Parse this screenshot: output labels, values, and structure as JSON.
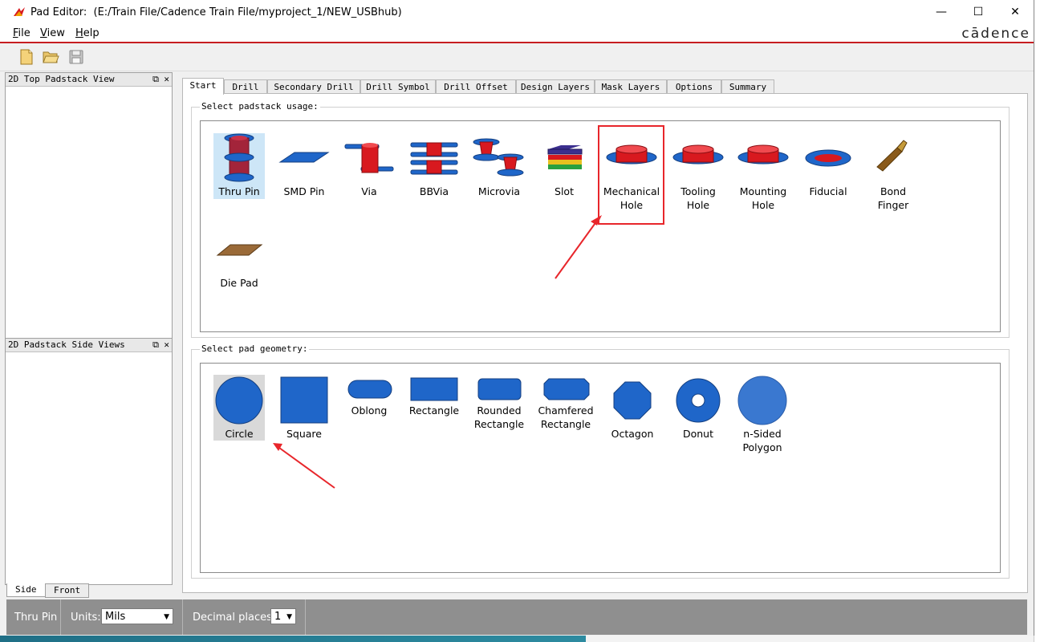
{
  "window": {
    "title_app": "Pad Editor:",
    "title_path": "(E:/Train File/Cadence Train File/myproject_1/NEW_USBhub)",
    "brand": "cādence",
    "controls": {
      "minimize": "—",
      "maximize": "☐",
      "close": "✕"
    }
  },
  "menu": [
    {
      "label": "File",
      "underline": "F",
      "rest": "ile"
    },
    {
      "label": "View",
      "underline": "V",
      "rest": "iew"
    },
    {
      "label": "Help",
      "underline": "H",
      "rest": "elp"
    }
  ],
  "toolbar": {
    "icons": [
      "new-file-icon",
      "open-folder-icon",
      "save-disk-icon"
    ]
  },
  "panels": {
    "top_view": {
      "title": "2D Top Padstack View"
    },
    "side_views": {
      "title": "2D Padstack Side Views"
    },
    "float_glyph": "⧉",
    "close_glyph": "✕",
    "side_tabs": [
      "Side",
      "Front"
    ]
  },
  "tabs": [
    "Start",
    "Drill",
    "Secondary Drill",
    "Drill Symbol",
    "Drill Offset",
    "Design Layers",
    "Mask Layers",
    "Options",
    "Summary"
  ],
  "usage": {
    "label": "Select padstack usage:",
    "items": [
      {
        "line1": "Thru Pin",
        "line2": ""
      },
      {
        "line1": "SMD Pin",
        "line2": ""
      },
      {
        "line1": "Via",
        "line2": ""
      },
      {
        "line1": "BBVia",
        "line2": ""
      },
      {
        "line1": "Microvia",
        "line2": ""
      },
      {
        "line1": "Slot",
        "line2": ""
      },
      {
        "line1": "Mechanical",
        "line2": "Hole"
      },
      {
        "line1": "Tooling",
        "line2": "Hole"
      },
      {
        "line1": "Mounting",
        "line2": "Hole"
      },
      {
        "line1": "Fiducial",
        "line2": ""
      },
      {
        "line1": "Bond",
        "line2": "Finger"
      },
      {
        "line1": "Die Pad",
        "line2": ""
      }
    ],
    "selected": "Thru Pin"
  },
  "geometry": {
    "label": "Select pad geometry:",
    "items": [
      {
        "line1": "Circle",
        "line2": ""
      },
      {
        "line1": "Square",
        "line2": ""
      },
      {
        "line1": "Oblong",
        "line2": ""
      },
      {
        "line1": "Rectangle",
        "line2": ""
      },
      {
        "line1": "Rounded",
        "line2": "Rectangle"
      },
      {
        "line1": "Chamfered",
        "line2": "Rectangle"
      },
      {
        "line1": "Octagon",
        "line2": ""
      },
      {
        "line1": "Donut",
        "line2": ""
      },
      {
        "line1": "n-Sided",
        "line2": "Polygon"
      }
    ],
    "selected": "Circle"
  },
  "status": {
    "usage": "Thru Pin",
    "units_label": "Units:",
    "units_value": "Mils",
    "decimal_label": "Decimal places:",
    "decimal_value": "1"
  },
  "colors": {
    "accent_red": "#c61d21",
    "pad_blue": "#1f66c9",
    "hole_red": "#d8191f",
    "selection": "#cde6f7"
  }
}
